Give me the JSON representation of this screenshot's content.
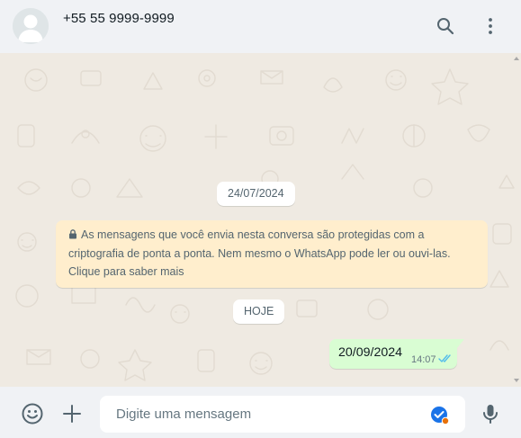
{
  "header": {
    "contact_name": "+55 55 9999-9999",
    "icons": {
      "avatar": "default-avatar",
      "search": "search-icon",
      "menu": "menu-icon"
    }
  },
  "chat": {
    "date_chip_1": "24/07/2024",
    "encryption_notice": "As mensagens que você envia nesta conversa são protegidas com a criptografia de ponta a ponta. Nem mesmo o WhatsApp pode ler ou ouvi-las. Clique para saber mais",
    "date_chip_2": "HOJE",
    "messages": [
      {
        "text": "20/09/2024",
        "time": "14:07",
        "direction": "outgoing",
        "status": "read"
      }
    ]
  },
  "footer": {
    "input_placeholder": "Digite uma mensagem",
    "input_value": "",
    "icons": {
      "emoji": "emoji-icon",
      "attach": "plus-icon",
      "mic": "mic-icon"
    }
  },
  "colors": {
    "header_bg": "#f0f2f5",
    "chat_bg": "#efeae2",
    "outgoing_bubble": "#d9fdd3",
    "encryption_bg": "#ffeecd",
    "read_tick": "#53bdeb",
    "icon_gray": "#54656f"
  }
}
